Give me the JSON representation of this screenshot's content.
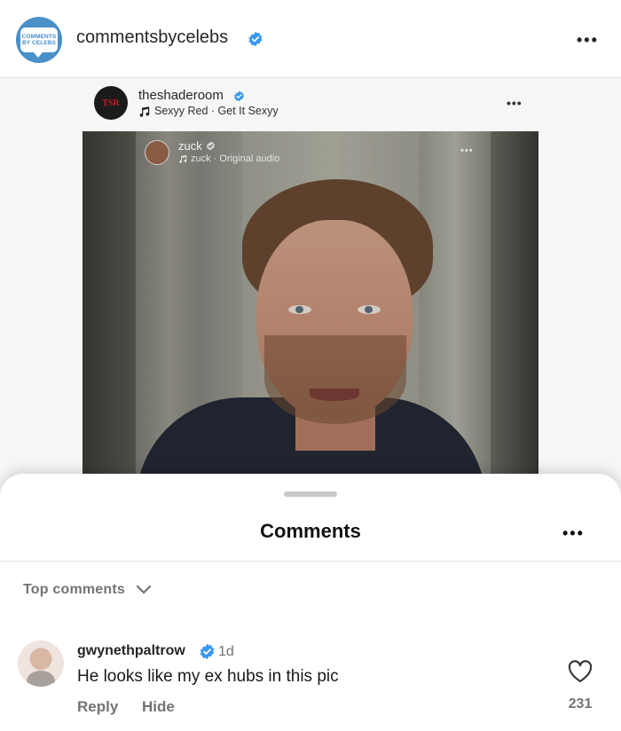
{
  "post": {
    "account_name": "commentsbycelebs",
    "account_avatar_text": [
      "COMMENTS",
      "BY CELEBS"
    ],
    "inner_post": {
      "account_name": "theshaderoom",
      "avatar_text": "TSR",
      "audio": "Sexyy Red · Get It Sexyy",
      "video": {
        "account_name": "zuck",
        "audio": "zuck · Original audio"
      }
    }
  },
  "comments": {
    "title": "Comments",
    "sort_label": "Top comments",
    "items": [
      {
        "username": "gwynethpaltrow",
        "verified": true,
        "time": "1d",
        "text": "He looks like my ex hubs in this pic",
        "reply_label": "Reply",
        "hide_label": "Hide",
        "likes": "231"
      }
    ]
  },
  "colors": {
    "verified_blue": "#3897f0",
    "secondary_text": "#737373",
    "primary_text": "#262626"
  }
}
